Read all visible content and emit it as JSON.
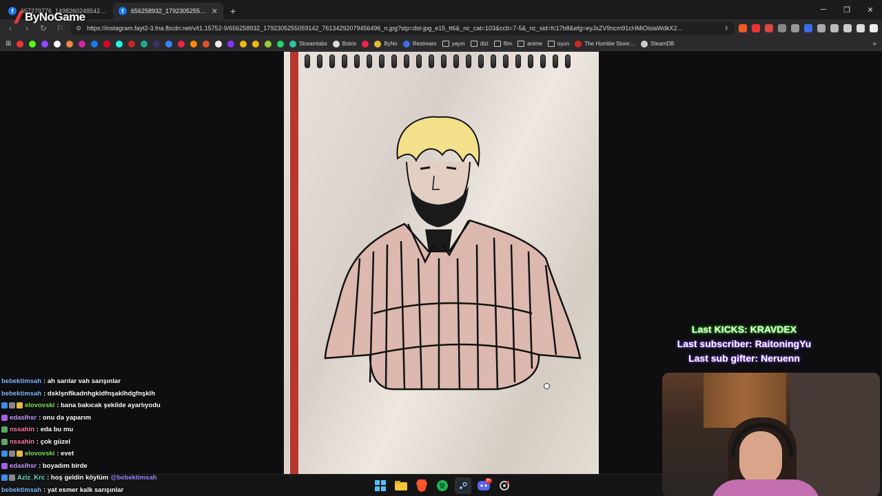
{
  "browser": {
    "tabs": [
      {
        "title": "657279776_1498260248542652_79..."
      },
      {
        "title": "656258932_1792305255059142_"
      }
    ],
    "new_tab_label": "+",
    "address": "https://instagram.fayt2-3.fna.fbcdn.net/v/t1.15752-9/656258932_1792305255059142_76134292079456496_n.jpg?stp=dst-jpg_e15_tt6&_nc_cat=103&ccb=7-5&_nc_sid=fc17b8&efg=eyJxZV9ncm91cHMiOlsiaWdkX2..."
  },
  "bookmarks": [
    {
      "label": "Streamlabs",
      "icon": "streamlabs-icon"
    },
    {
      "label": "Botrix",
      "icon": "botrix-icon"
    },
    {
      "label": "ByNo",
      "icon": "byno-icon"
    },
    {
      "label": "Restream",
      "icon": "restream-icon"
    },
    {
      "label": "yayın",
      "icon": "folder-icon"
    },
    {
      "label": "dizi",
      "icon": "folder-icon"
    },
    {
      "label": "film",
      "icon": "folder-icon"
    },
    {
      "label": "anime",
      "icon": "folder-icon"
    },
    {
      "label": "oyun",
      "icon": "folder-icon"
    },
    {
      "label": "The Humble Store:...",
      "icon": "humble-icon"
    },
    {
      "label": "SteamDB",
      "icon": "steamdb-icon"
    }
  ],
  "logo": {
    "text": "ByNoGame"
  },
  "stream_stats": {
    "last_kicks": "Last KICKS: KRAVDEX",
    "last_subscriber": "Last subscriber: RaitoningYu",
    "last_sub_gifter": "Last sub gifter: Neruenn"
  },
  "chat": [
    {
      "user": "bebektimsah",
      "text": ": ah sarılar vah sarışınlar",
      "color": "#7fb8ff",
      "badges": []
    },
    {
      "user": "bebektimsah",
      "text": ": dsklşnflkadnhgkldfnşaklhdgfnşklh",
      "color": "#7fb8ff",
      "badges": []
    },
    {
      "user": "elovovski",
      "text": ": bana bakıcak şekilde ayarlıyodu",
      "color": "#7be35a",
      "badges": [
        "#3a8ee8",
        "#888",
        "#e8b83a"
      ]
    },
    {
      "user": "edaslhsr",
      "text": ": onu da yaparım",
      "color": "#c79bff",
      "badges": [
        "#a35fe0"
      ]
    },
    {
      "user": "nssahin",
      "text": ": eda bu mu",
      "color": "#ff7aa8",
      "badges": [
        "#5aa860"
      ]
    },
    {
      "user": "nssahin",
      "text": ": çok güzel",
      "color": "#ff7aa8",
      "badges": [
        "#5aa860"
      ]
    },
    {
      "user": "elovovski",
      "text": ": evet",
      "color": "#7be35a",
      "badges": [
        "#3a8ee8",
        "#888",
        "#e8b83a"
      ]
    },
    {
      "user": "edaslhsr",
      "text": ": boyadım birde",
      "color": "#c79bff",
      "badges": [
        "#a35fe0"
      ]
    },
    {
      "user": "Aziz_Krc",
      "text": ": hoş geldin köylüm ",
      "mention": "@bebektimsah",
      "color": "#66e0c8",
      "badges": [
        "#3a8ee8",
        "#888"
      ]
    },
    {
      "user": "bebektimsah",
      "text": ": yat esmer kalk sarışınlar",
      "color": "#7fb8ff",
      "badges": []
    }
  ],
  "taskbar": [
    {
      "icon": "windows-start-icon"
    },
    {
      "icon": "file-explorer-icon"
    },
    {
      "icon": "brave-browser-icon"
    },
    {
      "icon": "spotify-icon"
    },
    {
      "icon": "steam-icon"
    },
    {
      "icon": "discord-icon",
      "badge": "9+"
    },
    {
      "icon": "settings-icon"
    }
  ],
  "colors": {
    "accent_red": "#e23b3b",
    "kicks_glow": "#3bd12a",
    "sub_glow": "#7a3de8"
  }
}
